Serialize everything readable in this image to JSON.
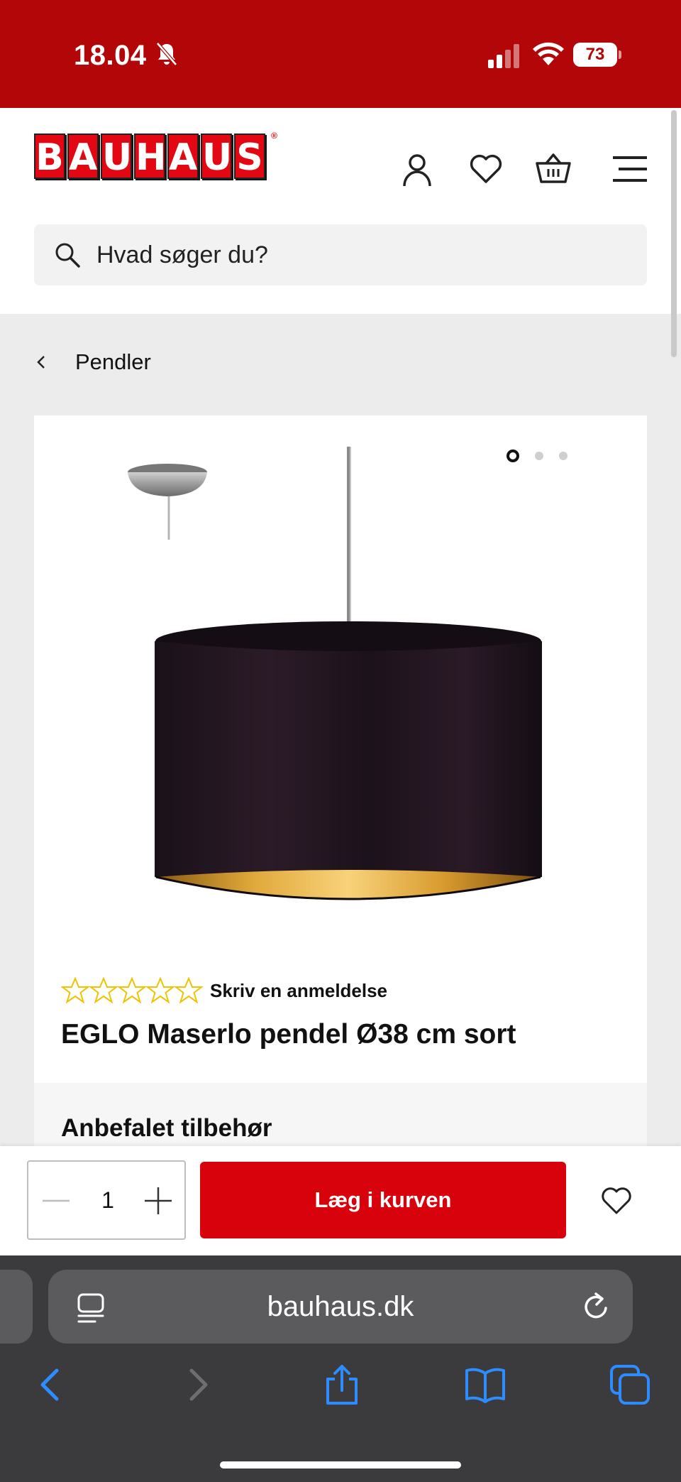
{
  "status": {
    "time": "18.04",
    "battery": "73",
    "bar_color": "#b20608"
  },
  "header": {
    "logo_letters": [
      "B",
      "A",
      "U",
      "H",
      "A",
      "U",
      "S"
    ],
    "logo_reg": "®",
    "icons": [
      "user-icon",
      "heart-icon",
      "basket-icon",
      "menu-icon"
    ]
  },
  "search": {
    "placeholder": "Hvad søger du?"
  },
  "breadcrumb": {
    "label": "Pendler"
  },
  "product": {
    "image_count": 3,
    "active_image": 1,
    "rating_stars": 5,
    "rating_value": 0,
    "review_link": "Skriv en anmeldelse",
    "title": "EGLO Maserlo pendel Ø38 cm sort"
  },
  "accessories": {
    "title": "Anbefalet tilbehør"
  },
  "cart": {
    "quantity": "1",
    "add_label": "Læg i kurven",
    "accent": "#d7020c"
  },
  "browser": {
    "url": "bauhaus.dk"
  }
}
